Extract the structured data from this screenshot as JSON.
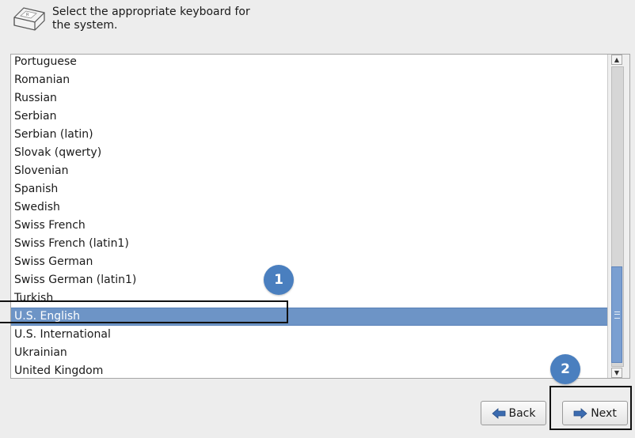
{
  "header": {
    "icon": "keyboard-key-icon",
    "title": "Select the appropriate keyboard for\nthe system."
  },
  "keyboard_list": {
    "items": [
      {
        "label": "Portuguese"
      },
      {
        "label": "Romanian"
      },
      {
        "label": "Russian"
      },
      {
        "label": "Serbian"
      },
      {
        "label": "Serbian (latin)"
      },
      {
        "label": "Slovak (qwerty)"
      },
      {
        "label": "Slovenian"
      },
      {
        "label": "Spanish"
      },
      {
        "label": "Swedish"
      },
      {
        "label": "Swiss French"
      },
      {
        "label": "Swiss French (latin1)"
      },
      {
        "label": "Swiss German"
      },
      {
        "label": "Swiss German (latin1)"
      },
      {
        "label": "Turkish"
      },
      {
        "label": "U.S. English",
        "selected": true
      },
      {
        "label": "U.S. International"
      },
      {
        "label": "Ukrainian"
      },
      {
        "label": "United Kingdom"
      }
    ],
    "selection_color": "#6d94c6"
  },
  "annotations": {
    "step1": "1",
    "step2": "2",
    "badge_color": "#4a7fbf"
  },
  "buttons": {
    "back_label": "Back",
    "back_icon": "arrow-left-icon",
    "next_label": "Next",
    "next_icon": "arrow-right-icon",
    "arrow_color": "#3b6bb0"
  }
}
